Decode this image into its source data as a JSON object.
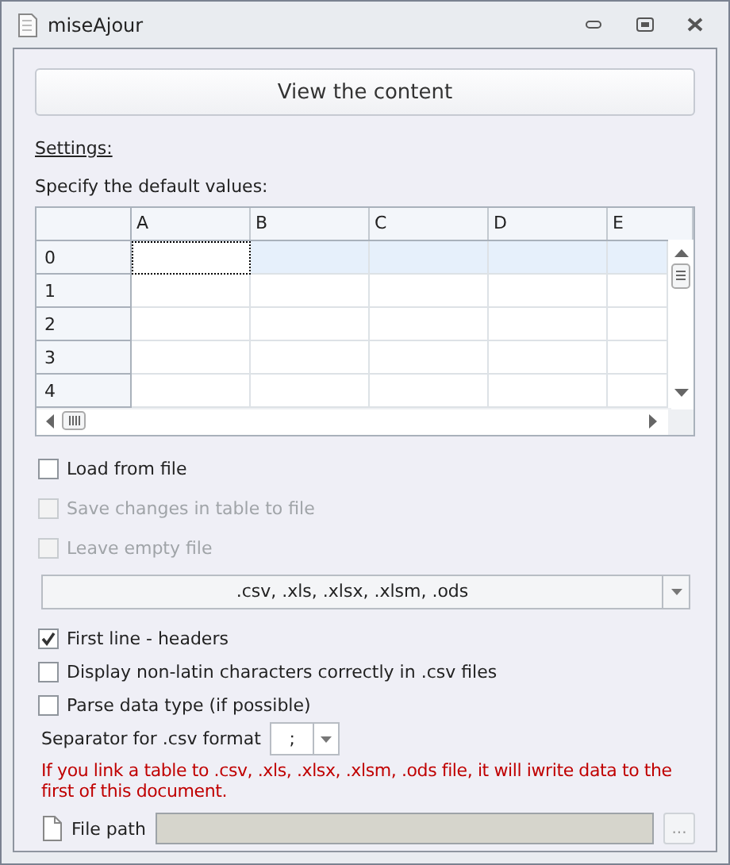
{
  "window": {
    "title": "miseAjour"
  },
  "view_button": {
    "label": "View the content"
  },
  "settings_label": "Settings:",
  "defaults_label": "Specify the default values:",
  "grid": {
    "columns": [
      "A",
      "B",
      "C",
      "D",
      "E"
    ],
    "rows": [
      {
        "header": "0",
        "selected": true,
        "cells": [
          {
            "focused": true
          },
          {
            "focused": false
          },
          {
            "focused": false
          },
          {
            "focused": false
          },
          {
            "focused": false
          }
        ]
      },
      {
        "header": "1",
        "selected": false,
        "cells": [
          {
            "focused": false
          },
          {
            "focused": false
          },
          {
            "focused": false
          },
          {
            "focused": false
          },
          {
            "focused": false
          }
        ]
      },
      {
        "header": "2",
        "selected": false,
        "cells": [
          {
            "focused": false
          },
          {
            "focused": false
          },
          {
            "focused": false
          },
          {
            "focused": false
          },
          {
            "focused": false
          }
        ]
      },
      {
        "header": "3",
        "selected": false,
        "cells": [
          {
            "focused": false
          },
          {
            "focused": false
          },
          {
            "focused": false
          },
          {
            "focused": false
          },
          {
            "focused": false
          }
        ]
      },
      {
        "header": "4",
        "selected": false,
        "cells": [
          {
            "focused": false
          },
          {
            "focused": false
          },
          {
            "focused": false
          },
          {
            "focused": false
          },
          {
            "focused": false
          }
        ]
      }
    ]
  },
  "file_options": [
    {
      "label": "Load from file",
      "checked": false,
      "disabled": false
    },
    {
      "label": "Save changes in table to file",
      "checked": false,
      "disabled": true
    },
    {
      "label": "Leave empty file",
      "checked": false,
      "disabled": true
    }
  ],
  "format_dropdown": {
    "value": ".csv, .xls, .xlsx, .xlsm, .ods"
  },
  "csv_options": [
    {
      "label": "First line - headers",
      "checked": true,
      "disabled": false
    },
    {
      "label": "Display non-latin characters correctly in .csv files",
      "checked": false,
      "disabled": false
    },
    {
      "label": "Parse data type (if possible)",
      "checked": false,
      "disabled": false
    }
  ],
  "separator": {
    "label": "Separator for .csv format",
    "value": ";"
  },
  "warning": "If you link a table to .csv, .xls, .xlsx, .xlsm, .ods file, it will iwrite data to the first of this document.",
  "file_path": {
    "label": "File path",
    "browse": "..."
  }
}
